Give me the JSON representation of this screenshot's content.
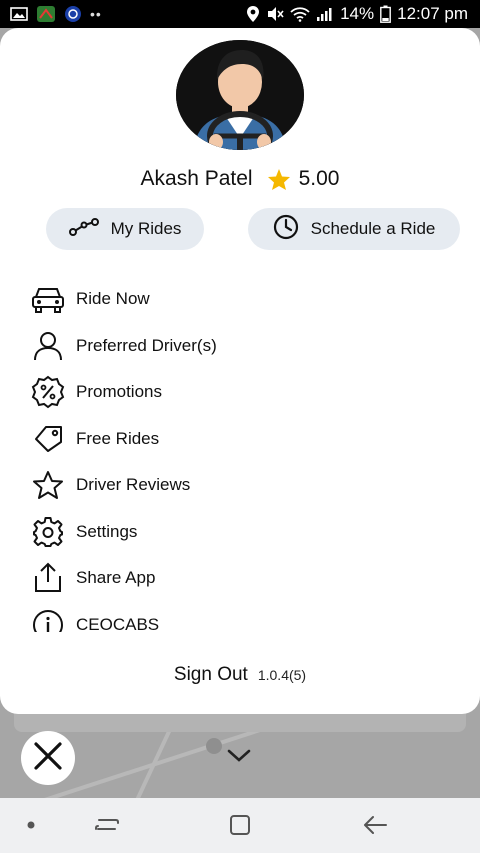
{
  "status_bar": {
    "battery_percent": "14%",
    "time": "12:07 pm"
  },
  "profile": {
    "name": "Akash Patel",
    "rating": "5.00"
  },
  "quick_actions": {
    "my_rides": "My Rides",
    "schedule_ride": "Schedule a Ride"
  },
  "menu": {
    "items": [
      {
        "label": "Ride Now",
        "icon": "car-icon"
      },
      {
        "label": "Preferred Driver(s)",
        "icon": "person-icon"
      },
      {
        "label": "Promotions",
        "icon": "percent-badge-icon"
      },
      {
        "label": "Free Rides",
        "icon": "tag-icon"
      },
      {
        "label": "Driver Reviews",
        "icon": "star-outline-icon"
      },
      {
        "label": "Settings",
        "icon": "gear-icon"
      },
      {
        "label": "Share App",
        "icon": "share-icon"
      },
      {
        "label": "CEOCABS",
        "icon": "info-icon"
      }
    ]
  },
  "footer": {
    "sign_out": "Sign Out",
    "version": "1.0.4(5)"
  },
  "colors": {
    "accent_star": "#f5b800",
    "pill_bg": "#e6ebf1",
    "overlay_bg": "#9a9a9a"
  }
}
